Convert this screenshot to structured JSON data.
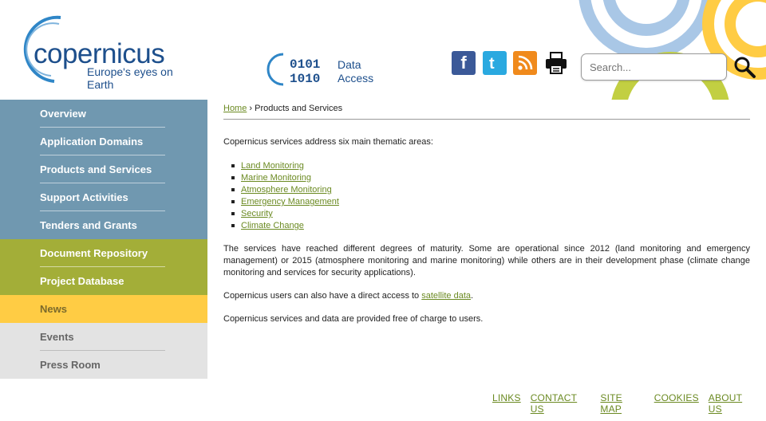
{
  "header": {
    "logo_word": "copernicus",
    "logo_tagline": "Europe's eyes on Earth",
    "data_access_label": "Data Access",
    "data_access_digits": [
      "0101",
      "1010"
    ],
    "search_placeholder": "Search...",
    "social": [
      {
        "name": "facebook-icon",
        "glyph": "f"
      },
      {
        "name": "twitter-icon",
        "glyph": "t"
      },
      {
        "name": "rss-icon",
        "glyph": "rss"
      },
      {
        "name": "print-icon",
        "glyph": "print"
      }
    ],
    "colors": {
      "brand_blue": "#1d4f8c",
      "deco_blue": "#a9c7e6",
      "deco_yellow": "#ffcc44",
      "deco_green": "#c2cf42"
    }
  },
  "sidebar": {
    "items": [
      {
        "label": "Overview",
        "group": "blue"
      },
      {
        "label": "Application Domains",
        "group": "blue"
      },
      {
        "label": "Products and Services",
        "group": "blue"
      },
      {
        "label": "Support Activities",
        "group": "blue"
      },
      {
        "label": "Tenders and Grants",
        "group": "blue"
      },
      {
        "label": "Document Repository",
        "group": "green"
      },
      {
        "label": "Project Database",
        "group": "green"
      },
      {
        "label": "News",
        "group": "yellow"
      },
      {
        "label": "Events",
        "group": "grey"
      },
      {
        "label": "Press Room",
        "group": "grey"
      }
    ]
  },
  "main": {
    "breadcrumb": {
      "home": "Home",
      "separator": " › ",
      "current": "Products and Services"
    },
    "intro": "Copernicus services address six main thematic areas:",
    "areas": [
      "Land Monitoring",
      "Marine Monitoring",
      "Atmosphere Monitoring",
      "Emergency Management",
      "Security",
      "Climate Change"
    ],
    "maturity": "The services have reached different degrees of maturity. Some are operational since 2012 (land monitoring and emergency management) or 2015 (atmosphere monitoring and marine monitoring) while others are in their development phase (climate change monitoring and services for security applications).",
    "access_prefix": "Copernicus users can also have a direct access to ",
    "access_link": "satellite data",
    "access_suffix": ".",
    "free": "Copernicus services and data are provided free of charge to users."
  },
  "footer": {
    "links": [
      "LINKS",
      "CONTACT US",
      "SITE MAP",
      "COOKIES",
      "ABOUT US"
    ]
  }
}
